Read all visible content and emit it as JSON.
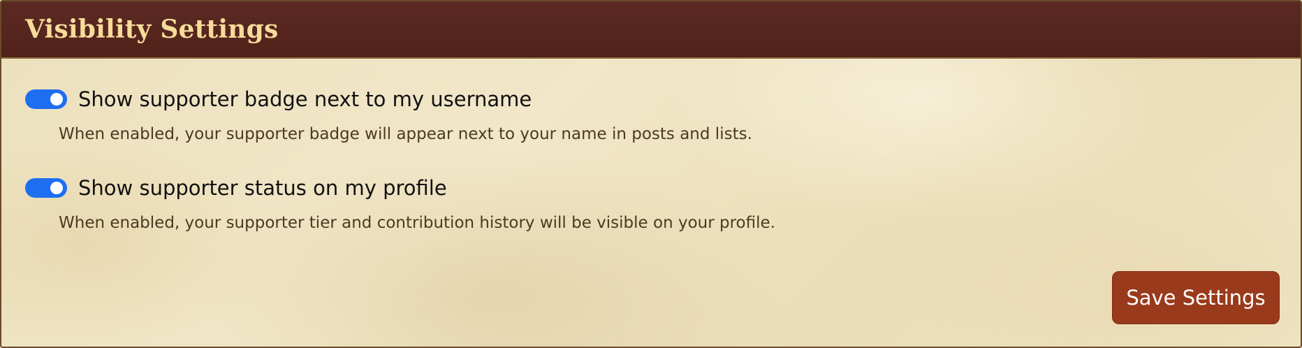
{
  "header": {
    "title": "Visibility Settings"
  },
  "settings": [
    {
      "label": "Show supporter badge next to my username",
      "description": "When enabled, your supporter badge will appear next to your name in posts and lists.",
      "enabled": true
    },
    {
      "label": "Show supporter status on my profile",
      "description": "When enabled, your supporter tier and contribution history will be visible on your profile.",
      "enabled": true
    }
  ],
  "actions": {
    "save_label": "Save Settings"
  },
  "colors": {
    "header_bg": "#56231b",
    "header_text": "#f6dc9a",
    "toggle_on": "#1e6ef2",
    "button_bg": "#9a3a1c",
    "parchment": "#efe4c5"
  }
}
